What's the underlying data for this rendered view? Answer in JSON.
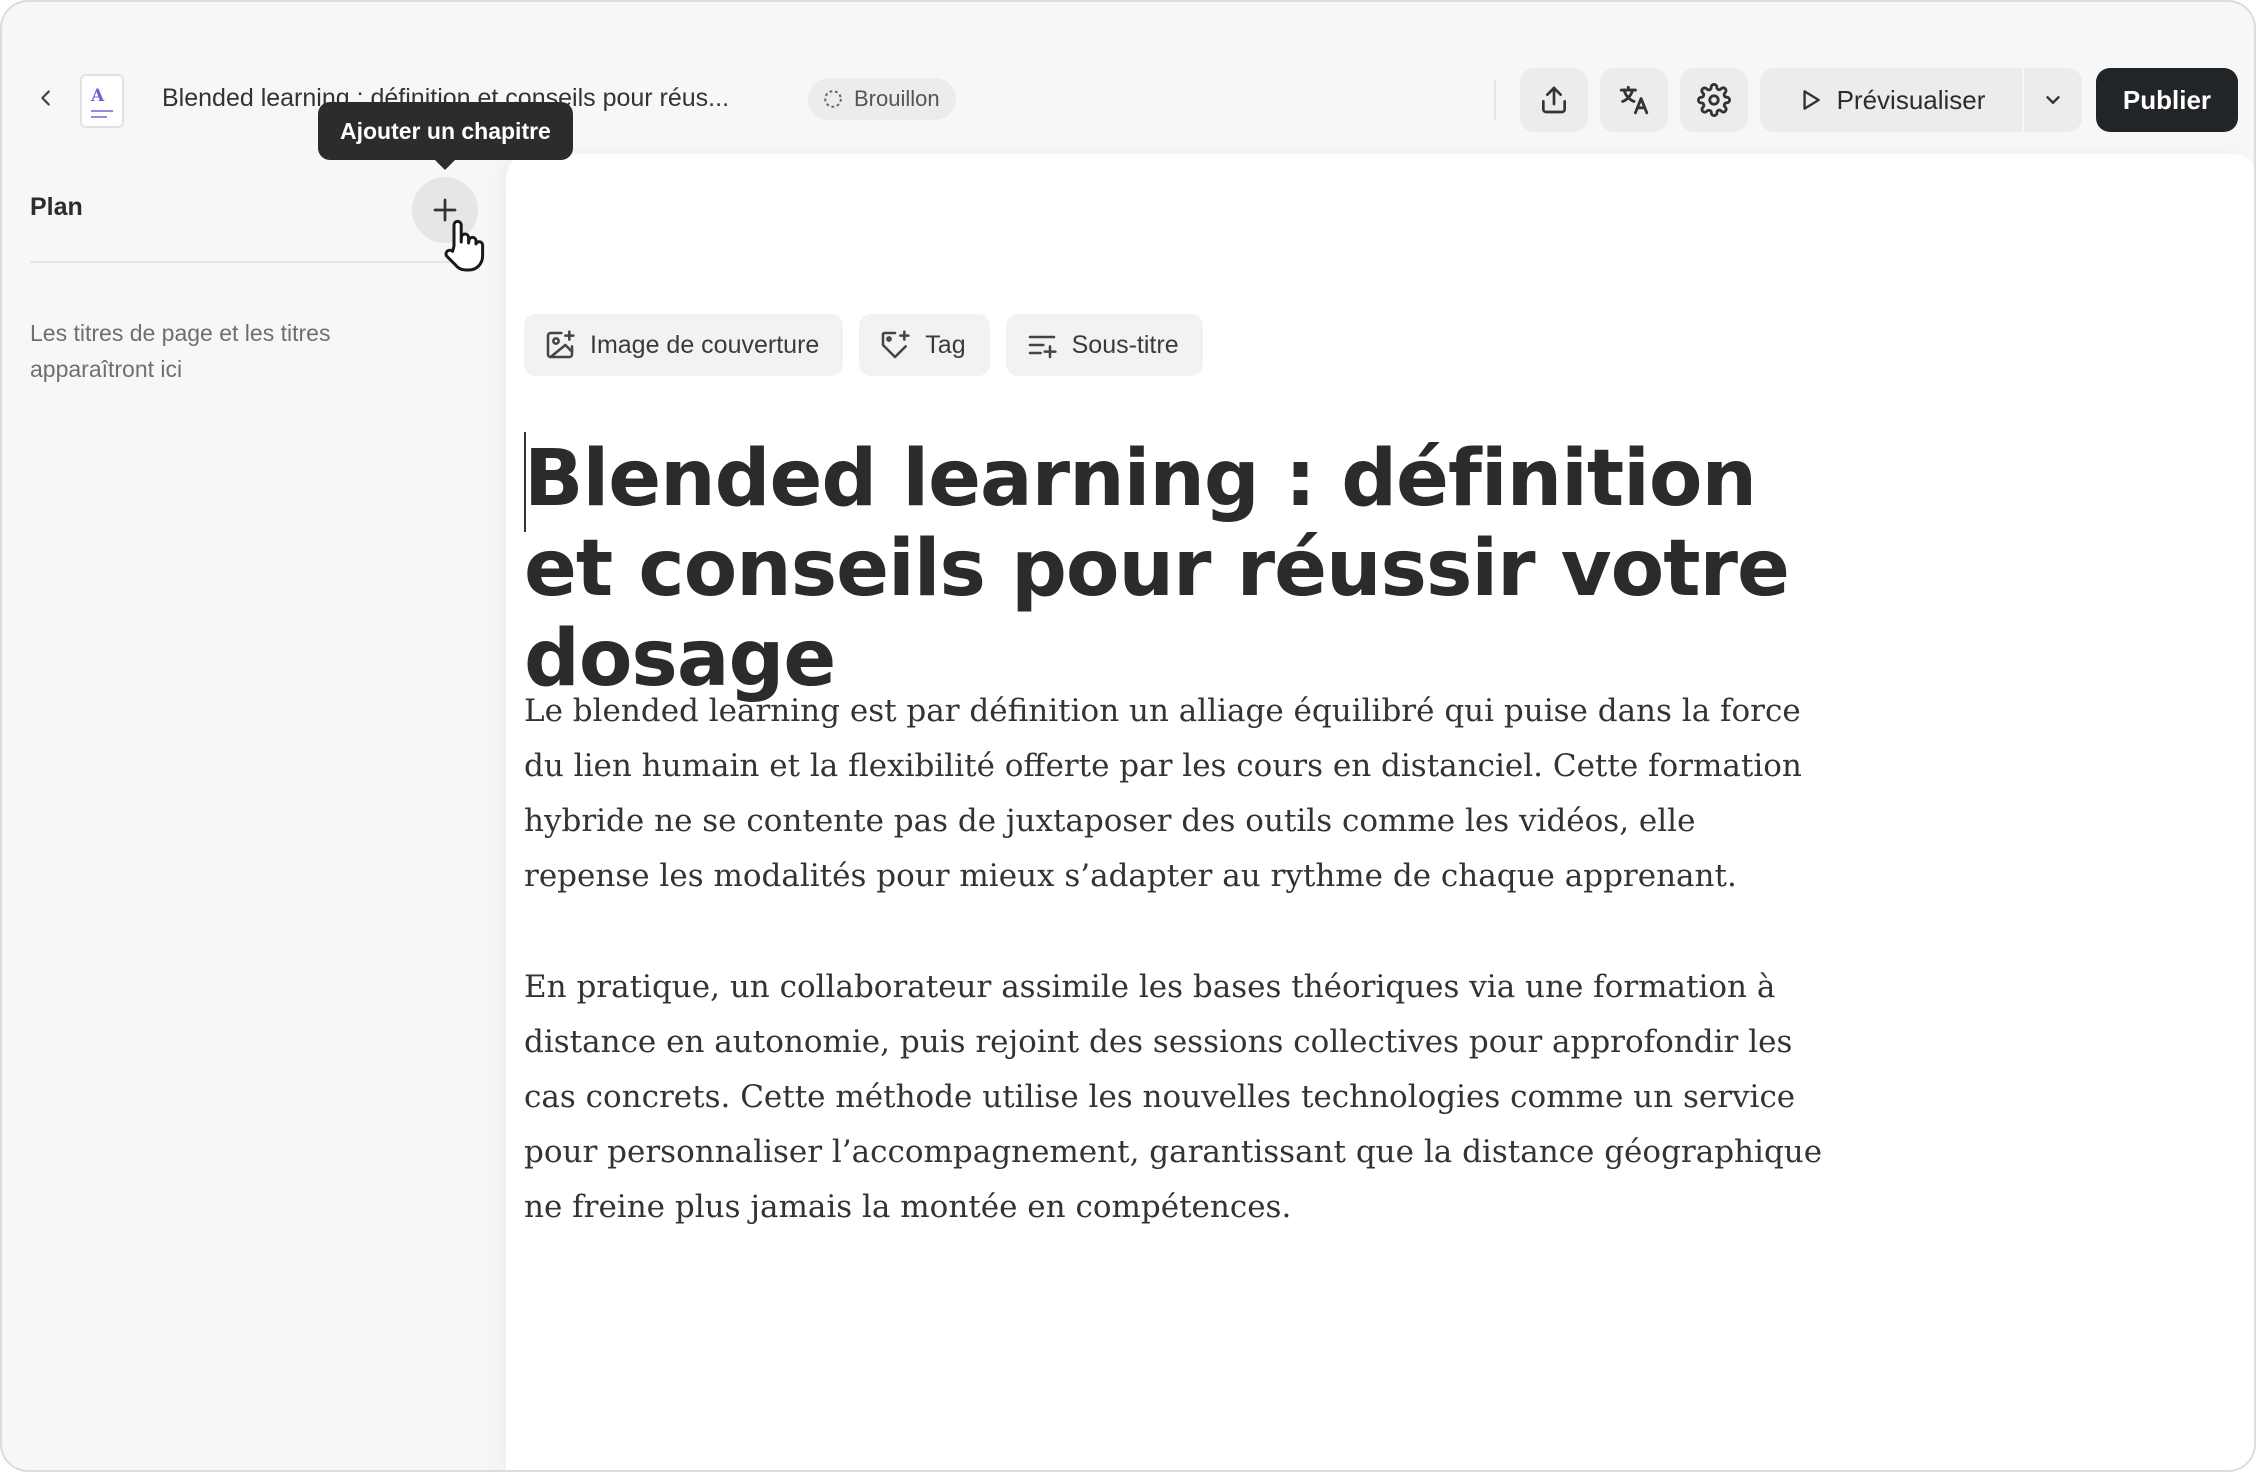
{
  "header": {
    "doc_title": "Blended learning : définition et conseils pour réus...",
    "status": "Brouillon",
    "preview_label": "Prévisualiser",
    "publish_label": "Publier",
    "icons": [
      "share-icon",
      "translate-icon",
      "settings-icon"
    ]
  },
  "sidebar": {
    "title": "Plan",
    "add_tooltip": "Ajouter un chapitre",
    "empty_text": "Les titres de page et les titres apparaîtront ici"
  },
  "editor": {
    "chips": [
      {
        "label": "Image de couverture",
        "icon": "image-add-icon"
      },
      {
        "label": "Tag",
        "icon": "tag-add-icon"
      },
      {
        "label": "Sous-titre",
        "icon": "subtitle-add-icon"
      }
    ],
    "title": "Blended learning : définition et conseils pour réussir votre dosage",
    "paragraphs": [
      "Le blended learning est par définition un alliage équilibré qui puise dans la force du lien humain et la flexibilité offerte par les cours en distanciel. Cette formation hybride ne se contente pas de juxtaposer des outils comme les vidéos, elle repense les modalités pour mieux s’adapter au rythme de chaque apprenant.",
      "En pratique, un collaborateur assimile les bases théoriques via une formation à distance en autonomie, puis rejoint des sessions collectives pour approfondir les cas concrets. Cette méthode utilise les nouvelles technologies comme un service pour personnaliser l’accompagnement, garantissant que la distance géographique ne freine plus jamais la montée en compétences."
    ]
  },
  "colors": {
    "accent": "#7c5cd6",
    "publish_bg": "#222527",
    "background": "#f7f7f7"
  }
}
